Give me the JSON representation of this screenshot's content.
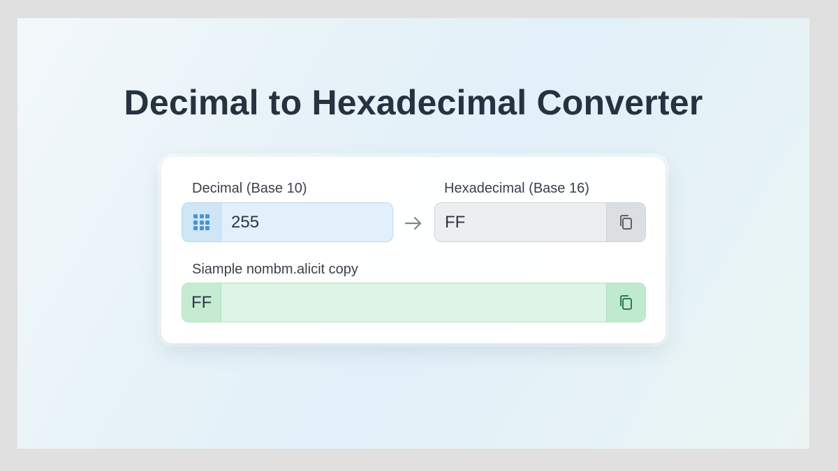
{
  "title": "Decimal to Hexadecimal Converter",
  "decimal": {
    "label": "Decimal (Base 10)",
    "value": "255",
    "icon": "keypad-icon"
  },
  "arrow_icon": "arrow-right-icon",
  "hex": {
    "label": "Hexadecimal (Base 16)",
    "value": "FF",
    "icon": "copy-icon"
  },
  "sample": {
    "label": "Siample nombm.alicit copy",
    "value": "FF",
    "icon": "copy-icon"
  },
  "colors": {
    "title": "#263240",
    "decimal_field": "#e2f0fb",
    "hex_field": "#eceef0",
    "sample_field": "#dcf5e6",
    "keypad_icon": "#4d93c8",
    "copy_icon_gray": "#5b6168",
    "copy_icon_green": "#2f7a4b"
  }
}
